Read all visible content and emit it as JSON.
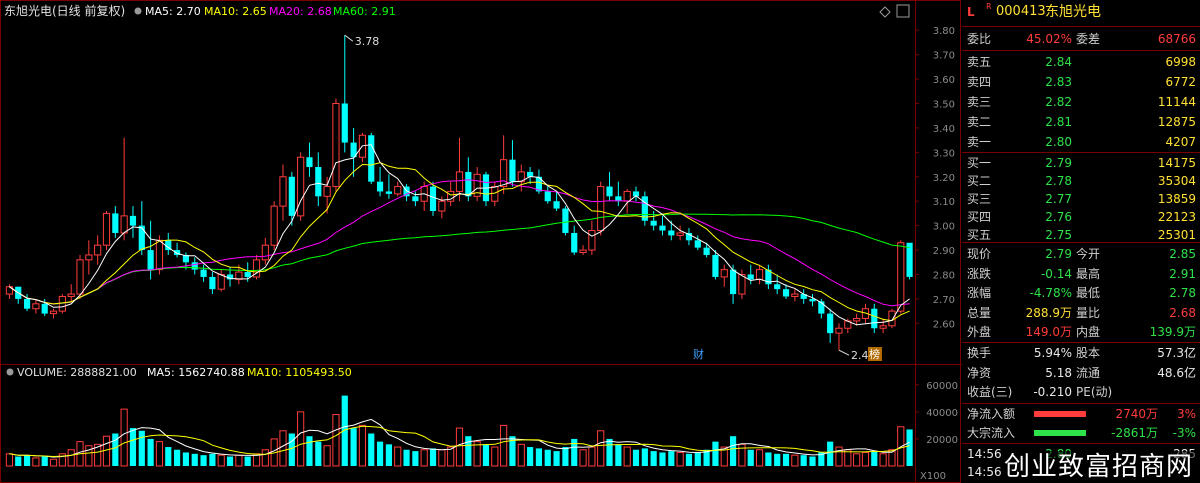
{
  "kline_header": {
    "stock_label": "东旭光电",
    "period_label": "(日线 前复权)",
    "ma5": "MA5: 2.70",
    "ma10": "MA10: 2.65",
    "ma20": "MA20: 2.68",
    "ma60": "MA60: 2.91"
  },
  "volume_header": {
    "volume": "VOLUME: 2888821.00",
    "ma5": "MA5: 1562740.88",
    "ma10": "MA10: 1105493.50"
  },
  "annotations": {
    "high": "3.78",
    "low": "2.49",
    "finance_tag": "财",
    "rank_tag": "榜",
    "vol_unit": "X100"
  },
  "colors": {
    "up": "#ff3c3c",
    "down": "#00ffff",
    "ma5": "#ffffff",
    "ma10": "#ffff00",
    "ma20": "#ff00ff",
    "ma60": "#00ff00",
    "grid": "#7a0000",
    "axis": "#8a8a8a"
  },
  "chart_data": [
    {
      "type": "candlestick",
      "title": "东旭光电 (日线 前复权)",
      "ylim": [
        2.45,
        3.85
      ],
      "yticks": [
        "3.80",
        "3.70",
        "3.60",
        "3.50",
        "3.40",
        "3.30",
        "3.20",
        "3.10",
        "3.00",
        "2.90",
        "2.80",
        "2.70",
        "2.60"
      ],
      "candles": [
        [
          2.72,
          2.76,
          2.7,
          2.75
        ],
        [
          2.75,
          2.75,
          2.68,
          2.7
        ],
        [
          2.7,
          2.72,
          2.65,
          2.66
        ],
        [
          2.66,
          2.7,
          2.64,
          2.68
        ],
        [
          2.68,
          2.7,
          2.63,
          2.64
        ],
        [
          2.64,
          2.66,
          2.62,
          2.65
        ],
        [
          2.65,
          2.72,
          2.64,
          2.71
        ],
        [
          2.71,
          2.76,
          2.69,
          2.72
        ],
        [
          2.72,
          2.88,
          2.7,
          2.86
        ],
        [
          2.86,
          2.94,
          2.8,
          2.88
        ],
        [
          2.88,
          2.96,
          2.84,
          2.92
        ],
        [
          2.92,
          3.06,
          2.9,
          3.05
        ],
        [
          3.05,
          3.08,
          2.95,
          2.97
        ],
        [
          2.97,
          3.36,
          2.94,
          3.04
        ],
        [
          3.04,
          3.08,
          2.95,
          3.0
        ],
        [
          3.0,
          3.1,
          2.88,
          2.9
        ],
        [
          2.9,
          3.02,
          2.78,
          2.82
        ],
        [
          2.82,
          2.96,
          2.8,
          2.94
        ],
        [
          2.94,
          2.97,
          2.88,
          2.9
        ],
        [
          2.9,
          2.93,
          2.87,
          2.88
        ],
        [
          2.88,
          2.89,
          2.82,
          2.85
        ],
        [
          2.85,
          2.87,
          2.8,
          2.82
        ],
        [
          2.82,
          2.84,
          2.77,
          2.79
        ],
        [
          2.79,
          2.81,
          2.72,
          2.74
        ],
        [
          2.74,
          2.82,
          2.73,
          2.8
        ],
        [
          2.8,
          2.83,
          2.75,
          2.78
        ],
        [
          2.78,
          2.84,
          2.76,
          2.81
        ],
        [
          2.81,
          2.85,
          2.77,
          2.79
        ],
        [
          2.79,
          2.88,
          2.78,
          2.86
        ],
        [
          2.86,
          2.95,
          2.84,
          2.92
        ],
        [
          2.92,
          3.1,
          2.9,
          3.08
        ],
        [
          3.08,
          3.25,
          3.02,
          3.2
        ],
        [
          3.2,
          3.22,
          3.0,
          3.04
        ],
        [
          3.04,
          3.3,
          3.02,
          3.28
        ],
        [
          3.28,
          3.34,
          3.2,
          3.24
        ],
        [
          3.24,
          3.3,
          3.08,
          3.12
        ],
        [
          3.12,
          3.2,
          3.05,
          3.16
        ],
        [
          3.16,
          3.52,
          3.14,
          3.5
        ],
        [
          3.5,
          3.78,
          3.3,
          3.34
        ],
        [
          3.34,
          3.4,
          3.2,
          3.28
        ],
        [
          3.28,
          3.38,
          3.26,
          3.37
        ],
        [
          3.37,
          3.38,
          3.17,
          3.18
        ],
        [
          3.18,
          3.24,
          3.12,
          3.14
        ],
        [
          3.14,
          3.21,
          3.11,
          3.13
        ],
        [
          3.13,
          3.18,
          3.12,
          3.16
        ],
        [
          3.16,
          3.17,
          3.1,
          3.12
        ],
        [
          3.12,
          3.14,
          3.08,
          3.1
        ],
        [
          3.1,
          3.18,
          3.06,
          3.16
        ],
        [
          3.16,
          3.18,
          3.04,
          3.06
        ],
        [
          3.06,
          3.12,
          3.03,
          3.1
        ],
        [
          3.1,
          3.18,
          3.08,
          3.14
        ],
        [
          3.14,
          3.36,
          3.1,
          3.22
        ],
        [
          3.22,
          3.28,
          3.1,
          3.12
        ],
        [
          3.12,
          3.24,
          3.1,
          3.21
        ],
        [
          3.21,
          3.22,
          3.08,
          3.1
        ],
        [
          3.1,
          3.18,
          3.08,
          3.16
        ],
        [
          3.16,
          3.37,
          3.13,
          3.27
        ],
        [
          3.27,
          3.35,
          3.16,
          3.18
        ],
        [
          3.18,
          3.25,
          3.14,
          3.22
        ],
        [
          3.22,
          3.24,
          3.17,
          3.2
        ],
        [
          3.2,
          3.23,
          3.13,
          3.14
        ],
        [
          3.14,
          3.16,
          3.09,
          3.1
        ],
        [
          3.1,
          3.14,
          3.06,
          3.07
        ],
        [
          3.07,
          3.08,
          2.96,
          2.97
        ],
        [
          2.97,
          3.0,
          2.88,
          2.89
        ],
        [
          2.89,
          2.92,
          2.88,
          2.9
        ],
        [
          2.9,
          3.02,
          2.88,
          2.98
        ],
        [
          2.98,
          3.18,
          2.96,
          3.16
        ],
        [
          3.16,
          3.22,
          3.1,
          3.12
        ],
        [
          3.12,
          3.18,
          3.08,
          3.1
        ],
        [
          3.1,
          3.15,
          3.05,
          3.14
        ],
        [
          3.14,
          3.16,
          3.1,
          3.12
        ],
        [
          3.12,
          3.14,
          3.0,
          3.02
        ],
        [
          3.02,
          3.06,
          2.98,
          3.0
        ],
        [
          3.0,
          3.04,
          2.96,
          2.98
        ],
        [
          2.98,
          3.02,
          2.94,
          2.96
        ],
        [
          2.96,
          3.0,
          2.94,
          2.97
        ],
        [
          2.97,
          2.99,
          2.92,
          2.94
        ],
        [
          2.94,
          2.96,
          2.9,
          2.91
        ],
        [
          2.91,
          2.93,
          2.87,
          2.88
        ],
        [
          2.88,
          2.9,
          2.78,
          2.79
        ],
        [
          2.79,
          2.84,
          2.75,
          2.82
        ],
        [
          2.82,
          2.84,
          2.68,
          2.72
        ],
        [
          2.72,
          2.82,
          2.7,
          2.8
        ],
        [
          2.8,
          2.84,
          2.76,
          2.78
        ],
        [
          2.78,
          2.84,
          2.76,
          2.82
        ],
        [
          2.82,
          2.84,
          2.74,
          2.76
        ],
        [
          2.76,
          2.8,
          2.72,
          2.74
        ],
        [
          2.74,
          2.76,
          2.7,
          2.71
        ],
        [
          2.71,
          2.74,
          2.69,
          2.72
        ],
        [
          2.72,
          2.74,
          2.68,
          2.7
        ],
        [
          2.7,
          2.72,
          2.67,
          2.69
        ],
        [
          2.69,
          2.7,
          2.62,
          2.64
        ],
        [
          2.64,
          2.66,
          2.52,
          2.56
        ],
        [
          2.56,
          2.6,
          2.49,
          2.58
        ],
        [
          2.58,
          2.62,
          2.56,
          2.61
        ],
        [
          2.61,
          2.64,
          2.59,
          2.62
        ],
        [
          2.62,
          2.68,
          2.6,
          2.66
        ],
        [
          2.66,
          2.68,
          2.56,
          2.58
        ],
        [
          2.58,
          2.62,
          2.56,
          2.59
        ],
        [
          2.59,
          2.66,
          2.58,
          2.65
        ],
        [
          2.65,
          2.94,
          2.64,
          2.93
        ],
        [
          2.93,
          2.91,
          2.78,
          2.79
        ]
      ],
      "ma5_last": 2.7,
      "ma10_last": 2.65,
      "ma20_last": 2.68,
      "ma60_last": 2.91
    },
    {
      "type": "bar",
      "title": "VOLUME",
      "ylim": [
        0,
        65000
      ],
      "yticks": [
        "60000",
        "40000",
        "20000"
      ],
      "unit": "X100",
      "values": [
        9000,
        7000,
        8000,
        6000,
        7000,
        5000,
        9000,
        12000,
        18000,
        15000,
        16000,
        22000,
        24000,
        42000,
        28000,
        26000,
        20000,
        18000,
        14000,
        12000,
        10000,
        9000,
        8000,
        9000,
        8000,
        7000,
        8000,
        7000,
        9000,
        12000,
        20000,
        26000,
        24000,
        40000,
        22000,
        18000,
        15000,
        38000,
        52000,
        28000,
        30000,
        24000,
        18000,
        16000,
        14000,
        12000,
        11000,
        12000,
        13000,
        12000,
        14000,
        28000,
        22000,
        18000,
        16000,
        14000,
        30000,
        22000,
        16000,
        14000,
        13000,
        12000,
        11000,
        14000,
        20000,
        12000,
        14000,
        26000,
        20000,
        16000,
        14000,
        12000,
        13000,
        11000,
        10000,
        11000,
        10000,
        9000,
        10000,
        12000,
        18000,
        14000,
        22000,
        16000,
        12000,
        12000,
        10000,
        9000,
        9000,
        8000,
        8000,
        7000,
        10000,
        18000,
        14000,
        12000,
        9000,
        10000,
        11000,
        9000,
        12000,
        29000,
        27000
      ]
    }
  ],
  "quote_panel": {
    "flag": "L",
    "flag_sup": "R",
    "code": "000413",
    "name": "东旭光电",
    "weibi_label": "委比",
    "weibi_value": "45.02%",
    "weicha_label": "委差",
    "weicha_value": "68766",
    "sell": [
      {
        "label": "卖五",
        "price": "2.84",
        "vol": "6998"
      },
      {
        "label": "卖四",
        "price": "2.83",
        "vol": "6772"
      },
      {
        "label": "卖三",
        "price": "2.82",
        "vol": "11144"
      },
      {
        "label": "卖二",
        "price": "2.81",
        "vol": "12875"
      },
      {
        "label": "卖一",
        "price": "2.80",
        "vol": "4207"
      }
    ],
    "buy": [
      {
        "label": "买一",
        "price": "2.79",
        "vol": "14175"
      },
      {
        "label": "买二",
        "price": "2.78",
        "vol": "35304"
      },
      {
        "label": "买三",
        "price": "2.77",
        "vol": "13859"
      },
      {
        "label": "买四",
        "price": "2.76",
        "vol": "22123"
      },
      {
        "label": "买五",
        "price": "2.75",
        "vol": "25301"
      }
    ],
    "stats": [
      {
        "l1": "现价",
        "v1": "2.79",
        "c1": "green",
        "l2": "今开",
        "v2": "2.85",
        "c2": "green"
      },
      {
        "l1": "涨跌",
        "v1": "-0.14",
        "c1": "green",
        "l2": "最高",
        "v2": "2.91",
        "c2": "green"
      },
      {
        "l1": "涨幅",
        "v1": "-4.78%",
        "c1": "green",
        "l2": "最低",
        "v2": "2.78",
        "c2": "green"
      },
      {
        "l1": "总量",
        "v1": "288.9万",
        "c1": "yellow",
        "l2": "量比",
        "v2": "2.68",
        "c2": "red"
      },
      {
        "l1": "外盘",
        "v1": "149.0万",
        "c1": "red",
        "l2": "内盘",
        "v2": "139.9万",
        "c2": "green"
      }
    ],
    "stats2": [
      {
        "l1": "换手",
        "v1": "5.94%",
        "c1": "white",
        "l2": "股本",
        "v2": "57.3亿",
        "c2": "white"
      },
      {
        "l1": "净资",
        "v1": "5.18",
        "c1": "white",
        "l2": "流通",
        "v2": "48.6亿",
        "c2": "white"
      },
      {
        "l1": "收益(三)",
        "v1": "-0.210",
        "c1": "white",
        "l2": "PE(动)",
        "v2": "",
        "c2": "white"
      }
    ],
    "flow": [
      {
        "label": "净流入额",
        "value": "2740万",
        "pct": "3%",
        "bar": "#ff3c3c",
        "c": "red"
      },
      {
        "label": "大宗流入",
        "value": "-2861万",
        "pct": "-3%",
        "bar": "#2ee24a",
        "c": "green"
      }
    ],
    "ticks": [
      {
        "time": "14:56",
        "price": "2.80",
        "vol": "285"
      },
      {
        "time": "14:56",
        "price": "",
        "vol": ""
      }
    ]
  },
  "watermark": "创业致富招商网"
}
